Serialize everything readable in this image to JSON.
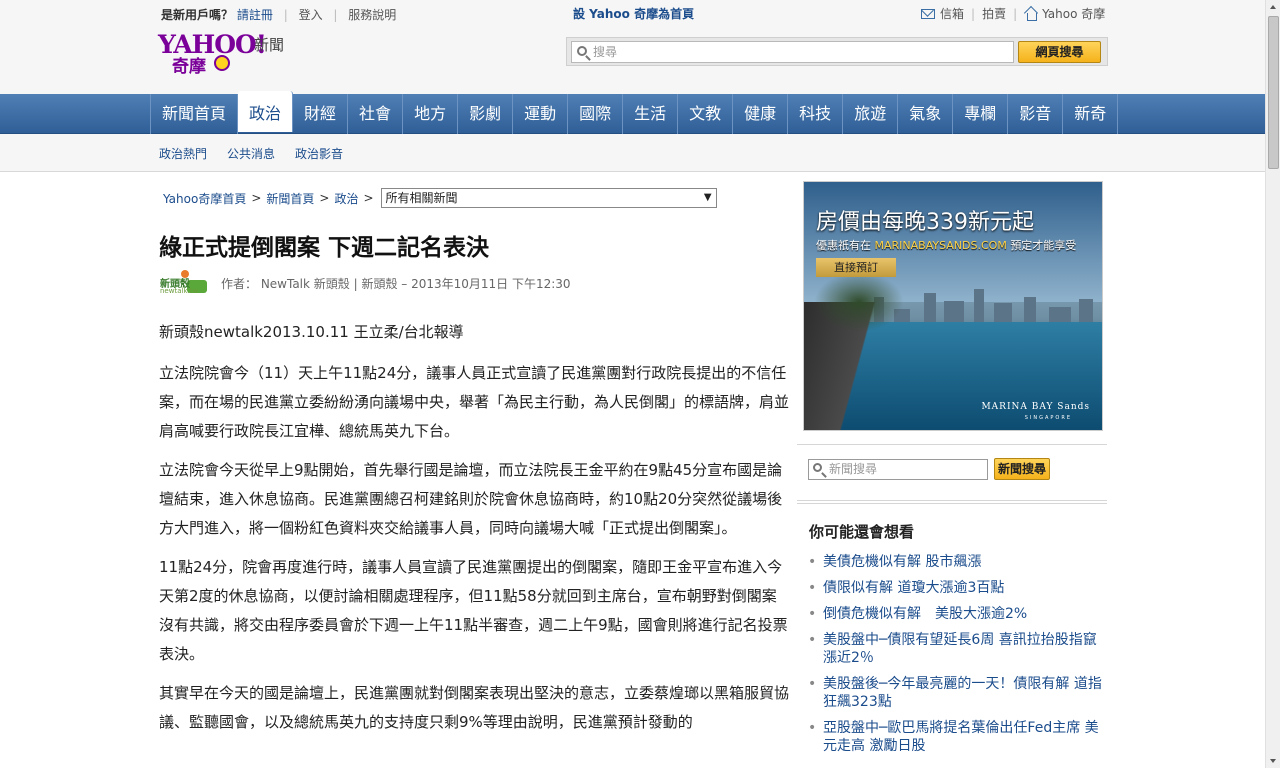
{
  "topbar": {
    "new_user_prompt": "是新用戶嗎？",
    "register": "請註冊",
    "login": "登入",
    "help": "服務說明",
    "set_homepage": "設 Yahoo 奇摩為首頁",
    "mail": "信箱",
    "auction": "拍賣",
    "yahoo_home": "Yahoo 奇摩"
  },
  "logo": {
    "yahoo": "YAHOO!",
    "sub": "奇摩",
    "section": "新聞"
  },
  "search": {
    "placeholder": "搜尋",
    "button": "網頁搜尋"
  },
  "nav": {
    "items": [
      "新聞首頁",
      "政治",
      "財經",
      "社會",
      "地方",
      "影劇",
      "運動",
      "國際",
      "生活",
      "文教",
      "健康",
      "科技",
      "旅遊",
      "氣象",
      "專欄",
      "影音",
      "新奇"
    ],
    "active": "政治"
  },
  "subnav": {
    "items": [
      "政治熱門",
      "公共消息",
      "政治影音"
    ]
  },
  "breadcrumb": {
    "items": [
      "Yahoo奇摩首頁",
      "新聞首頁",
      "政治"
    ],
    "select_value": "所有相關新聞"
  },
  "article": {
    "title": "綠正式提倒閣案 下週二記名表決",
    "source_logo": {
      "line1": "新頭殼",
      "line2": "newtalk.tw"
    },
    "byline": "作者： NewTalk 新頭殼 | 新頭殼 – 2013年10月11日 下午12:30",
    "paragraphs": [
      "新頭殼newtalk2013.10.11 王立柔/台北報導",
      "立法院院會今（11）天上午11點24分，議事人員正式宣讀了民進黨團對行政院長提出的不信任案，而在場的民進黨立委紛紛湧向議場中央，舉著「為民主行動，為人民倒閣」的標語牌，肩並肩高喊要行政院長江宜樺、總統馬英九下台。",
      "立法院會今天從早上9點開始，首先舉行國是論壇，而立法院長王金平約在9點45分宣布國是論壇結束，進入休息協商。民進黨團總召柯建銘則於院會休息協商時，約10點20分突然從議場後方大門進入，將一個粉紅色資料夾交給議事人員，同時向議場大喊「正式提出倒閣案」。",
      "11點24分，院會再度進行時，議事人員宣讀了民進黨團提出的倒閣案，隨即王金平宣布進入今天第2度的休息協商，以便討論相關處理程序，但11點58分就回到主席台，宣布朝野對倒閣案沒有共識，將交由程序委員會於下週一上午11點半審查，週二上午9點，國會則將進行記名投票表決。",
      "其實早在今天的國是論壇上，民進黨團就對倒閣案表現出堅決的意志，立委蔡煌瑯以黑箱服貿協議、監聽國會，以及總統馬英九的支持度只剩9%等理由說明，民進黨預計發動的"
    ]
  },
  "ad": {
    "headline": "房價由每晚339新元起",
    "sub_prefix": "優惠祇有在",
    "sub_url": "MARINABAYSANDS.COM",
    "sub_suffix": "預定才能享受",
    "button": "直接預訂",
    "brand": "MARINA BAY Sands",
    "brand_sub": "SINGAPORE"
  },
  "news_search": {
    "placeholder": "新聞搜尋",
    "button": "新聞搜尋"
  },
  "recommend": {
    "title": "你可能還會想看",
    "items": [
      "美債危機似有解 股市飆漲",
      "債限似有解 道瓊大漲逾3百點",
      "倒債危機似有解　美股大漲逾2%",
      "美股盤中─債限有望延長6周 喜訊拉抬股指竄漲近2％",
      "美股盤後─今年最亮麗的一天！債限有解 道指狂飆323點",
      "亞股盤中─歐巴馬將提名葉倫出任Fed主席 美元走高 激勵日股"
    ]
  },
  "colors": {
    "nav": "#3b6ca5",
    "link": "#1b4c8c",
    "brand": "#7b0099",
    "button": "#f5b21b"
  }
}
